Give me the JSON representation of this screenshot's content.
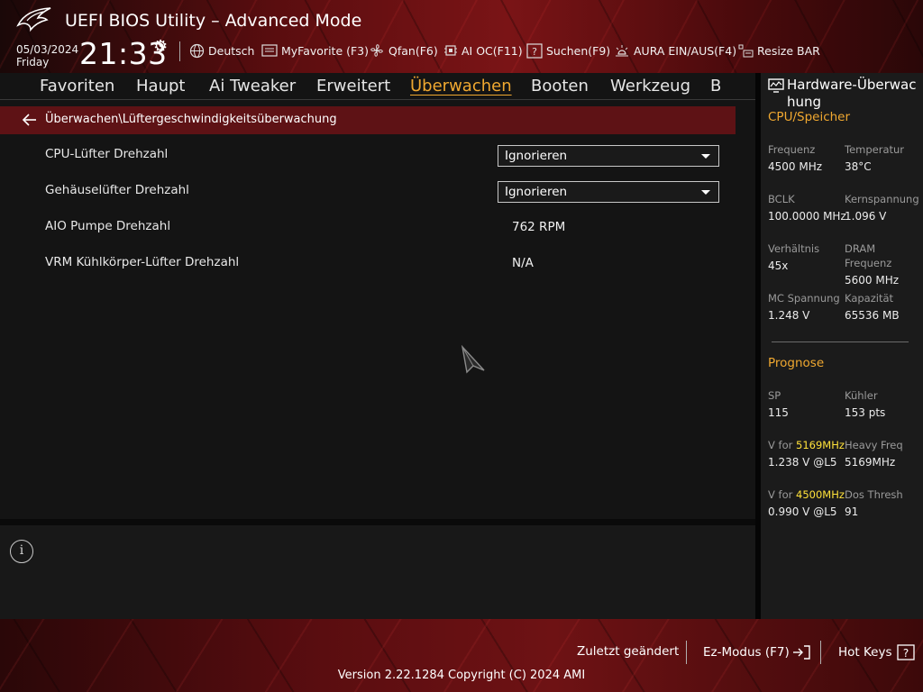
{
  "header": {
    "title": "UEFI BIOS Utility – Advanced Mode",
    "date": "05/03/2024",
    "day": "Friday",
    "time": "21:33",
    "toolbar": [
      {
        "label": "Deutsch",
        "icon": "globe-icon"
      },
      {
        "label": "MyFavorite (F3)",
        "icon": "favorite-icon"
      },
      {
        "label": "Qfan(F6)",
        "icon": "fan-icon"
      },
      {
        "label": "AI OC(F11)",
        "icon": "ai-chip-icon"
      },
      {
        "label": "Suchen(F9)",
        "icon": "search-help-icon"
      },
      {
        "label": "AURA EIN/AUS(F4)",
        "icon": "aura-light-icon"
      },
      {
        "label": "Resize BAR",
        "icon": "resize-bar-icon"
      }
    ]
  },
  "nav": {
    "tabs": [
      "Favoriten",
      "Haupt",
      "Ai Tweaker",
      "Erweitert",
      "Überwachen",
      "Booten",
      "Werkzeug",
      "B"
    ],
    "active": "Überwachen"
  },
  "breadcrumb": "Überwachen\\Lüftergeschwindigkeitsüberwachung",
  "settings": [
    {
      "label": "CPU-Lüfter Drehzahl",
      "type": "dropdown",
      "value": "Ignorieren"
    },
    {
      "label": "Gehäuselüfter Drehzahl",
      "type": "dropdown",
      "value": "Ignorieren"
    },
    {
      "label": "AIO Pumpe Drehzahl",
      "type": "readonly",
      "value": "762 RPM"
    },
    {
      "label": "VRM Kühlkörper-Lüfter Drehzahl",
      "type": "readonly",
      "value": "N/A"
    }
  ],
  "hw_monitor": {
    "title": "Hardware-Überwac hung",
    "cpu_section": "CPU/Speicher",
    "cpu": [
      {
        "label": "Frequenz",
        "value": "4500 MHz"
      },
      {
        "label": "Temperatur",
        "value": "38°C"
      },
      {
        "label": "BCLK",
        "value": "100.0000 MHz"
      },
      {
        "label": "Kernspannung",
        "value": "1.096 V"
      },
      {
        "label": "Verhältnis",
        "value": "45x"
      },
      {
        "label": "DRAM Frequenz",
        "value": "5600 MHz"
      },
      {
        "label": "MC Spannung",
        "value": "1.248 V"
      },
      {
        "label": "Kapazität",
        "value": "65536 MB"
      }
    ],
    "prognose_section": "Prognose",
    "sp_label": "SP",
    "sp_value": "115",
    "cooler_label": "Kühler",
    "cooler_value": "153 pts",
    "v1_prefix": "V for ",
    "v1_freq": "5169MHz",
    "v1_value": "1.238 V @L5",
    "heavy_label": "Heavy Freq",
    "heavy_value": "5169MHz",
    "v2_prefix": "V for ",
    "v2_freq": "4500MHz",
    "v2_value": "0.990 V @L5",
    "dos_label": "Dos Thresh",
    "dos_value": "91"
  },
  "footer": {
    "last_changed": "Zuletzt geändert",
    "ez_mode": "Ez-Modus (F7)",
    "hot_keys": "Hot Keys",
    "version": "Version 2.22.1284 Copyright (C) 2024 AMI"
  },
  "colors": {
    "accent": "#f0a830",
    "highlight": "#ffe23a",
    "brand_red": "#5e1215"
  }
}
